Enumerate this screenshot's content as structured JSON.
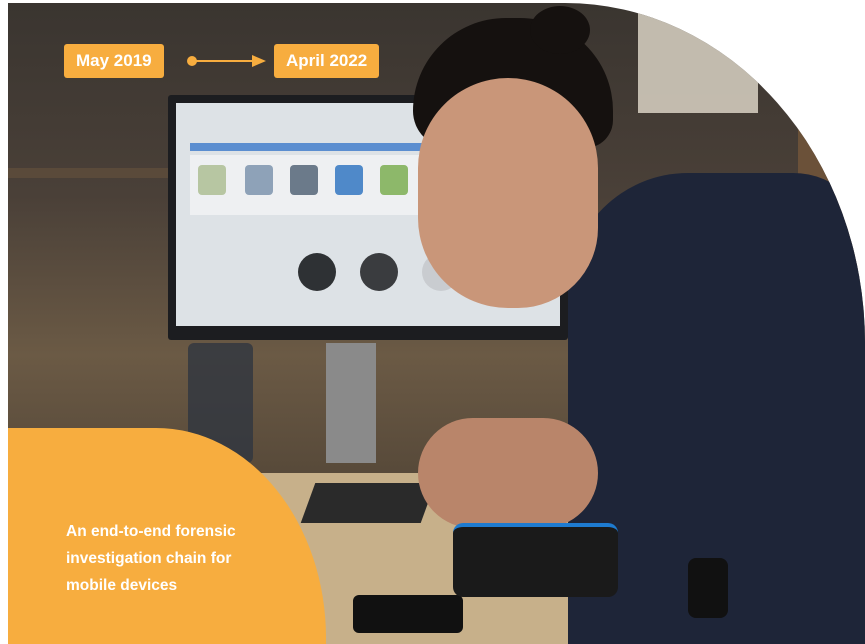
{
  "timeline": {
    "start_label": "May 2019",
    "end_label": "April 2022",
    "arrow_icon": "arrow-right-icon"
  },
  "tagline": {
    "line1": "An end-to-end forensic",
    "line2": "investigation chain for",
    "line3": "mobile devices"
  },
  "colors": {
    "accent": "#f7ad3f",
    "text_on_accent": "#ffffff"
  }
}
